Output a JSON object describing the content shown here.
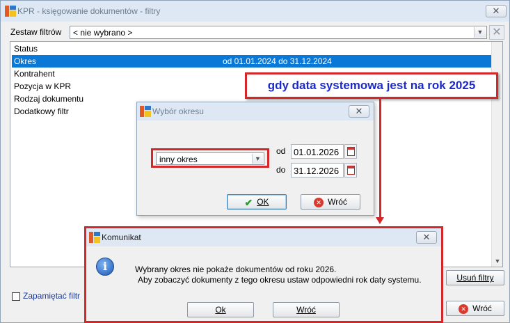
{
  "main_window": {
    "title": "KPR - księgowanie dokumentów - filtry",
    "close_symbol": "✕",
    "filter_set_label": "Zestaw filtrów",
    "filter_set_value": "< nie wybrano >",
    "clear_symbol": "✕",
    "filter_rows": [
      {
        "label": "Status",
        "value": ""
      },
      {
        "label": "Okres",
        "value": "od 01.01.2024 do 31.12.2024"
      },
      {
        "label": "Kontrahent",
        "value": ""
      },
      {
        "label": "Pozycja w KPR",
        "value": ""
      },
      {
        "label": "Rodzaj dokumentu",
        "value": ""
      },
      {
        "label": "Dodatkowy filtr",
        "value": ""
      }
    ],
    "remove_filters_label": "Usuń filtry",
    "remember_filter_label": "Zapamiętać filtr",
    "back_label": "Wróć"
  },
  "callout": {
    "text": "gdy data systemowa jest na rok 2025"
  },
  "period_dialog": {
    "title": "Wybór okresu",
    "close_symbol": "✕",
    "period_type_value": "inny okres",
    "from_label": "od",
    "from_value": "01.01.2026",
    "to_label": "do",
    "to_value": "31.12.2026",
    "ok_label": "OK",
    "back_label": "Wróć"
  },
  "message_dialog": {
    "title": "Komunikat",
    "close_symbol": "✕",
    "line1": "Wybrany okres nie pokaże dokumentów od roku 2026.",
    "line2": "Aby zobaczyć dokumenty z tego okresu ustaw odpowiedni rok daty systemu.",
    "ok_label": "Ok",
    "back_label": "Wróć"
  },
  "icons": {
    "app": "app-logo-icon",
    "info": "info-icon",
    "ok": "checkmark-icon",
    "cancel": "cancel-icon",
    "calendar": "calendar-icon",
    "dropdown": "chevron-down-icon"
  },
  "colors": {
    "selection": "#0a78d7",
    "highlight_border": "#d4272a",
    "callout_text": "#1c2ac8"
  }
}
